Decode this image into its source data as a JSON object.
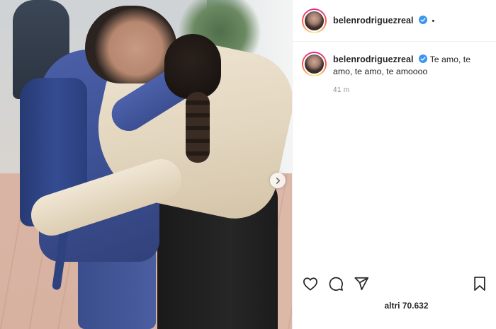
{
  "post": {
    "username": "belenrodriguezreal",
    "header_dot": "•",
    "caption": "Te amo, te amo, te amo, te amoooo",
    "time": "41 m",
    "likes_text": "altri 70.632"
  },
  "icons": {
    "verified": "verified-badge-icon",
    "like": "heart-icon",
    "comment": "comment-icon",
    "share": "paper-plane-icon",
    "save": "bookmark-icon",
    "next": "chevron-right-icon"
  },
  "colors": {
    "verified_blue": "#3897f0",
    "text": "#262626",
    "muted": "#8e8e8e"
  }
}
